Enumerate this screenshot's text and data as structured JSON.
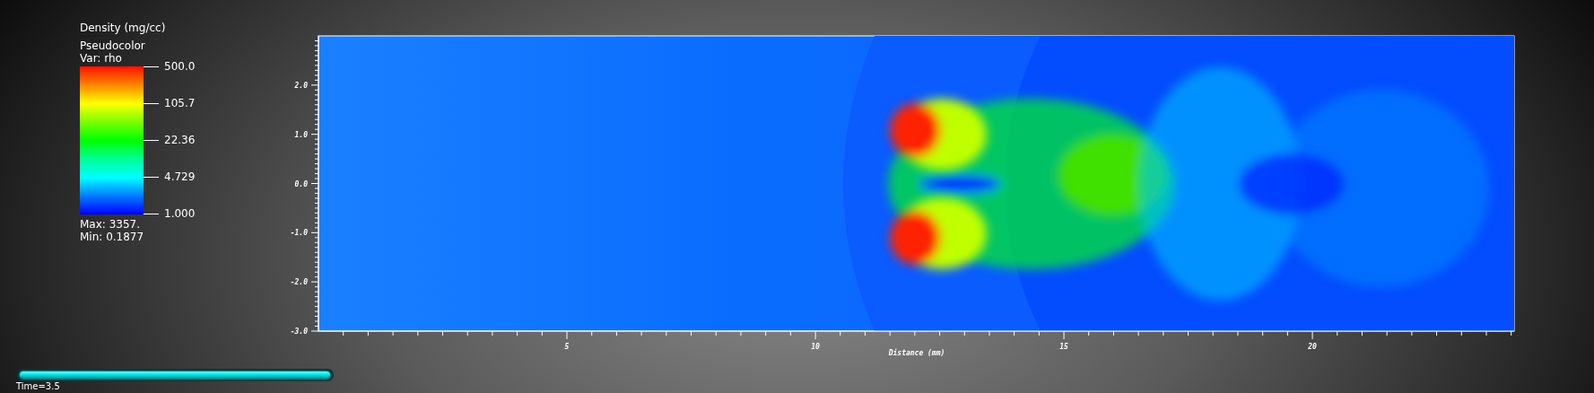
{
  "legend": {
    "title": "Density (mg/cc)",
    "plot_type": "Pseudocolor",
    "variable": "Var: rho",
    "ticks": [
      "500.0",
      "105.7",
      "22.36",
      "4.729",
      "1.000"
    ],
    "max": "Max:  3357.",
    "min": "Min:  0.1877"
  },
  "plot": {
    "x_axis": {
      "title": "Distance (mm)",
      "labels": [
        "5",
        "10",
        "15",
        "20"
      ]
    },
    "y_axis": {
      "labels": [
        "2.0",
        "1.0",
        "0.0",
        "-1.0",
        "-2.0",
        "-3.0"
      ]
    }
  },
  "time_slider": {
    "level": 1,
    "label": "Time=3.5"
  }
}
